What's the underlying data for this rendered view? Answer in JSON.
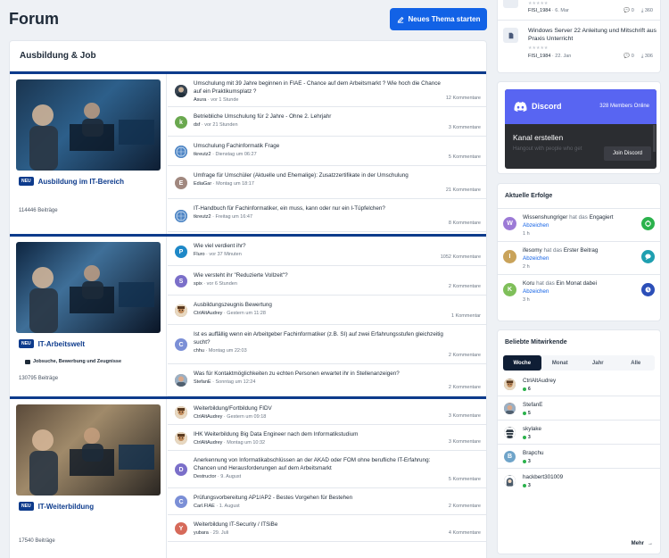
{
  "page": {
    "title": "Forum",
    "new_thread_label": "Neues Thema starten"
  },
  "board": {
    "title": "Ausbildung & Job",
    "categories": [
      {
        "name": "Ausbildung im IT-Bereich",
        "badge": "NEU",
        "posts": "114446 Beiträge",
        "threads": [
          {
            "title": "Umschulung mit 39 Jahre beginnen in FIAE - Chance auf dem Arbeitsmarkt ? Wie hoch die Chance auf ein Praktikumsplatz ?",
            "user": "Asura",
            "time": "vor 1 Stunde",
            "count": "12 Kommentare",
            "avatar": "photo",
            "color": "#4d5a68"
          },
          {
            "title": "Betriebliche Umschulung für 2 Jahre - Ohne 2. Lehrjahr",
            "user": "dsf",
            "time": "vor 21 Stunden",
            "count": "3 Kommentare",
            "avatar": "k",
            "color": "#6aa84f"
          },
          {
            "title": "Umschulung Fachinformatik Frage",
            "user": "tkreutz2",
            "time": "Dienstag um 06:27",
            "count": "5 Kommentare",
            "avatar": "globe",
            "color": "#5b8fc9"
          },
          {
            "title": "Umfrage für Umschüler (Aktuelle und Ehemalige): Zusatzzertifikate in der Umschulung",
            "user": "EdiaGar",
            "time": "Montag um 18:17",
            "count": "21 Kommentare",
            "avatar": "E",
            "color": "#a1887f"
          },
          {
            "title": "IT-Handbuch für Fachinformatiker, ein muss, kann oder nur ein I-Tüpfelchen?",
            "user": "tkreutz2",
            "time": "Freitag um 16:47",
            "count": "8 Kommentare",
            "avatar": "globe",
            "color": "#5b8fc9"
          }
        ]
      },
      {
        "name": "IT-Arbeitswelt",
        "badge": "NEU",
        "sub": "Jobsuche, Bewerbung und Zeugnisse",
        "posts": "130795 Beiträge",
        "threads": [
          {
            "title": "Wie viel verdient ihr?",
            "user": "Fluro",
            "time": "vor 37 Minuten",
            "count": "1052 Kommentare",
            "avatar": "P",
            "color": "#1e88c7"
          },
          {
            "title": "Wie versteht ihr \"Reduzierte Vollzeit\"?",
            "user": "spix",
            "time": "vor 6 Stunden",
            "count": "2 Kommentare",
            "avatar": "S",
            "color": "#7b6fc9"
          },
          {
            "title": "Ausbildungszeugnis Bewertung",
            "user": "CtrlAltAudrey",
            "time": "Gestern um 11:28",
            "count": "1 Kommentar",
            "avatar": "face",
            "color": "#8a6a4a"
          },
          {
            "title": "Ist es auffällig wenn ein Arbeitgeber Fachinformatiker (z.B. SI) auf zwei Erfahrungsstufen gleichzeitig sucht?",
            "user": "chhu",
            "time": "Montag um 22:03",
            "count": "2 Kommentare",
            "avatar": "C",
            "color": "#7b8fd6"
          },
          {
            "title": "Was für Kontaktmöglichkeiten zu echten Personen erwartet ihr in Stellenanzeigen?",
            "user": "StefanE",
            "time": "Sonntag um 12:24",
            "count": "2 Kommentare",
            "avatar": "photo2",
            "color": "#b07a5a"
          }
        ]
      },
      {
        "name": "IT-Weiterbildung",
        "badge": "NEU",
        "posts": "17540 Beiträge",
        "threads": [
          {
            "title": "Weiterbildung/Fortbildung FIDV",
            "user": "CtrlAltAudrey",
            "time": "Gestern um 09:18",
            "count": "3 Kommentare",
            "avatar": "face",
            "color": "#8a6a4a"
          },
          {
            "title": "IHK Weiterbildung Big Data Engineer nach dem Informatikstudium",
            "user": "CtrlAltAudrey",
            "time": "Montag um 10:32",
            "count": "3 Kommentare",
            "avatar": "face",
            "color": "#8a6a4a"
          },
          {
            "title": "Anerkennung von Informatikabschlüssen an der AKAD oder FOM ohne berufliche IT-Erfahrung: Chancen und Herausforderungen auf dem Arbeitsmarkt",
            "user": "Destructor",
            "time": "9. August",
            "count": "5 Kommentare",
            "avatar": "D",
            "color": "#7b6fc9"
          },
          {
            "title": "Prüfungsvorbereitung AP1/AP2 - Bestes Vorgehen für Bestehen",
            "user": "Carl.FIAE",
            "time": "1. August",
            "count": "2 Kommentare",
            "avatar": "C",
            "color": "#7b8fd6"
          },
          {
            "title": "Weiterbildung IT-Security / ITSiBe",
            "user": "yubara",
            "time": "29. Juli",
            "count": "4 Kommentare",
            "avatar": "Y",
            "color": "#d66a5a"
          }
        ]
      }
    ]
  },
  "downloads": [
    {
      "title": "",
      "user": "FISI_1984",
      "date": "6. Mar",
      "comments": "0",
      "downloads": "360"
    },
    {
      "title": "Windows Server 22 Anleitung und Mitschrift aus Praxis Unterricht",
      "user": "FISI_1984",
      "date": "22. Jan",
      "comments": "0",
      "downloads": "306"
    }
  ],
  "discord": {
    "brand": "Discord",
    "members": "328 Members Online",
    "heading": "Kanal erstellen",
    "sub": "Hangout with people who get",
    "join": "Join Discord"
  },
  "achievements": {
    "title": "Aktuelle Erfolge",
    "link": "Abzeichen",
    "items": [
      {
        "user": "Wissenshungriger",
        "mid": "hat das",
        "badge": "Engagiert",
        "time": "1 h",
        "letter": "W",
        "color": "#9c7ad6",
        "icon_color": "#2bb24c"
      },
      {
        "user": "ifesomy",
        "mid": "hat das",
        "badge": "Erster Beitrag",
        "time": "2 h",
        "letter": "I",
        "color": "#c9a35a",
        "icon_color": "#1f9fb0"
      },
      {
        "user": "Koru",
        "mid": "hat das",
        "badge": "Ein Monat dabei",
        "time": "3 h",
        "letter": "K",
        "color": "#7fbf5a",
        "icon_color": "#2c4fb8"
      }
    ]
  },
  "popular": {
    "title": "Beliebte Mitwirkende",
    "tabs": [
      "Woche",
      "Monat",
      "Jahr",
      "Alle"
    ],
    "members": [
      {
        "name": "CtrlAltAudrey",
        "points": "6",
        "avatar": "face",
        "color": "#8a6a4a"
      },
      {
        "name": "StefanE",
        "points": "5",
        "avatar": "photo2",
        "color": "#b07a5a"
      },
      {
        "name": "skylake",
        "points": "3",
        "avatar": "spy",
        "color": "#2f3a44"
      },
      {
        "name": "Brapchu",
        "points": "3",
        "avatar": "B",
        "color": "#6fa4c9"
      },
      {
        "name": "hackbert301009",
        "points": "3",
        "avatar": "hacker",
        "color": "#4a5a6a"
      }
    ],
    "more": "Mehr"
  },
  "colors": {
    "accent": "#1262e6",
    "navy": "#0d3b8c",
    "discord": "#5865f2"
  }
}
